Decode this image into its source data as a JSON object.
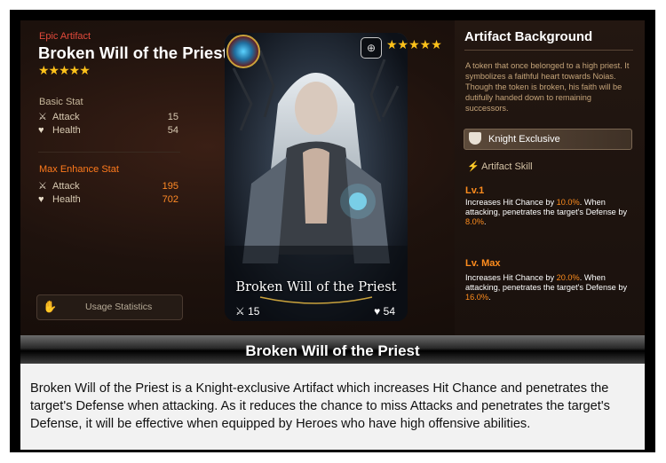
{
  "artifact": {
    "rarity": "Epic Artifact",
    "name": "Broken Will of the Priest",
    "stars": "★★★★★"
  },
  "basic_stat": {
    "title": "Basic Stat",
    "attack_label": "Attack",
    "attack_value": "15",
    "health_label": "Health",
    "health_value": "54"
  },
  "max_stat": {
    "title": "Max Enhance Stat",
    "attack_label": "Attack",
    "attack_value": "195",
    "health_label": "Health",
    "health_value": "702"
  },
  "usage_button": {
    "label": "Usage Statistics"
  },
  "card": {
    "name": "Broken Will of the Priest",
    "attack": "15",
    "health": "54",
    "stars": "★★★★★"
  },
  "background": {
    "title": "Artifact Background",
    "text": "A token that once belonged to a high priest. It symbolizes a faithful heart towards Noias. Though the token is broken, his faith will be dutifully handed down to remaining successors."
  },
  "exclusive": {
    "label": "Knight Exclusive"
  },
  "skill": {
    "title": "Artifact Skill",
    "lv1_label": "Lv.1",
    "lv1_pre": "Increases Hit Chance by ",
    "lv1_hit": "10.0%",
    "lv1_mid": ". When attacking, penetrates the target's Defense by ",
    "lv1_def": "8.0%",
    "lv1_end": ".",
    "lvmax_label": "Lv. Max",
    "lvmax_pre": "Increases Hit Chance by ",
    "lvmax_hit": "20.0%",
    "lvmax_mid": ". When attacking, penetrates the target's Defense by ",
    "lvmax_def": "16.0%",
    "lvmax_end": "."
  },
  "caption": {
    "title": "Broken Will of the Priest"
  },
  "description": "Broken Will of the Priest is a Knight-exclusive Artifact which increases Hit Chance and penetrates the target's Defense when attacking. As it reduces the chance to miss Attacks and penetrates the target's Defense, it will be effective when equipped by Heroes who have high offensive abilities.",
  "colors": {
    "accent_orange": "#ff8a26",
    "rarity_red": "#e24a3b",
    "star_gold": "#ffc21a"
  },
  "icons": [
    "sword-icon",
    "heart-icon",
    "zoom-icon",
    "shield-icon",
    "lightning-icon",
    "usage-stats-icon"
  ]
}
